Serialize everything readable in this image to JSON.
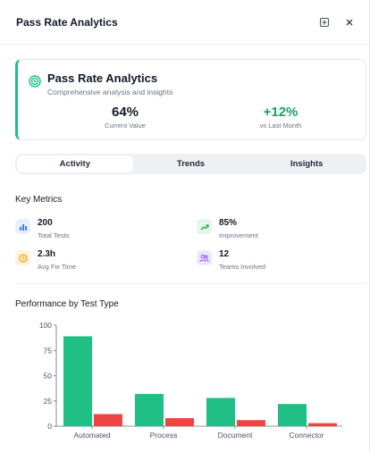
{
  "header": {
    "title": "Pass Rate Analytics"
  },
  "summary": {
    "title": "Pass Rate Analytics",
    "subtitle": "Comprehensive analysis and insights",
    "stats": [
      {
        "value": "64%",
        "label": "Current Value",
        "color": "#111827"
      },
      {
        "value": "+12%",
        "label": "vs Last Month",
        "color": "#1aa06d"
      }
    ],
    "accent": "#1fbf86"
  },
  "tabs": [
    {
      "label": "Activity",
      "active": true
    },
    {
      "label": "Trends",
      "active": false
    },
    {
      "label": "Insights",
      "active": false
    }
  ],
  "metrics": {
    "title": "Key Metrics",
    "items": [
      {
        "value": "200",
        "label": "Total Tests",
        "icon": "bar-chart-icon",
        "color": "#3b82f6",
        "bg": "#e6efff"
      },
      {
        "value": "85%",
        "label": "Improvement",
        "icon": "trending-up-icon",
        "color": "#16a34a",
        "bg": "#e4f7ea"
      },
      {
        "value": "2.3h",
        "label": "Avg Fix Time",
        "icon": "clock-icon",
        "color": "#f59e0b",
        "bg": "#fff2da"
      },
      {
        "value": "12",
        "label": "Teams Involved",
        "icon": "users-icon",
        "color": "#8b5cf6",
        "bg": "#efe7ff"
      }
    ]
  },
  "chart_section": {
    "title": "Performance by Test Type"
  },
  "chart_data": {
    "type": "bar",
    "categories": [
      "Automated",
      "Process",
      "Document",
      "Connector"
    ],
    "series": [
      {
        "values": [
          89,
          32,
          28,
          22
        ],
        "color": "#1fbf86"
      },
      {
        "values": [
          12,
          8,
          6,
          3
        ],
        "color": "#ef4444"
      }
    ],
    "ylim": [
      0,
      100
    ],
    "yticks": [
      0,
      25,
      50,
      75,
      100
    ],
    "grid": false
  }
}
